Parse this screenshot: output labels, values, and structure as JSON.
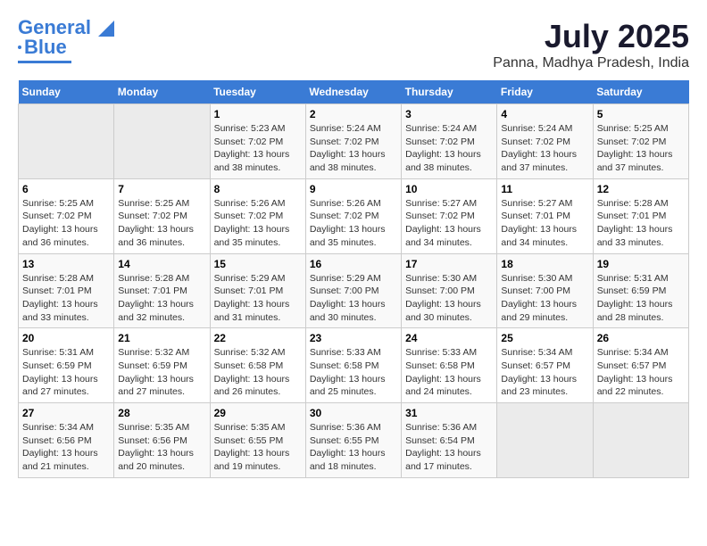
{
  "logo": {
    "text1": "General",
    "text2": "Blue"
  },
  "title": "July 2025",
  "subtitle": "Panna, Madhya Pradesh, India",
  "days_of_week": [
    "Sunday",
    "Monday",
    "Tuesday",
    "Wednesday",
    "Thursday",
    "Friday",
    "Saturday"
  ],
  "weeks": [
    [
      {
        "num": "",
        "sunrise": "",
        "sunset": "",
        "daylight": ""
      },
      {
        "num": "",
        "sunrise": "",
        "sunset": "",
        "daylight": ""
      },
      {
        "num": "1",
        "sunrise": "Sunrise: 5:23 AM",
        "sunset": "Sunset: 7:02 PM",
        "daylight": "Daylight: 13 hours and 38 minutes."
      },
      {
        "num": "2",
        "sunrise": "Sunrise: 5:24 AM",
        "sunset": "Sunset: 7:02 PM",
        "daylight": "Daylight: 13 hours and 38 minutes."
      },
      {
        "num": "3",
        "sunrise": "Sunrise: 5:24 AM",
        "sunset": "Sunset: 7:02 PM",
        "daylight": "Daylight: 13 hours and 38 minutes."
      },
      {
        "num": "4",
        "sunrise": "Sunrise: 5:24 AM",
        "sunset": "Sunset: 7:02 PM",
        "daylight": "Daylight: 13 hours and 37 minutes."
      },
      {
        "num": "5",
        "sunrise": "Sunrise: 5:25 AM",
        "sunset": "Sunset: 7:02 PM",
        "daylight": "Daylight: 13 hours and 37 minutes."
      }
    ],
    [
      {
        "num": "6",
        "sunrise": "Sunrise: 5:25 AM",
        "sunset": "Sunset: 7:02 PM",
        "daylight": "Daylight: 13 hours and 36 minutes."
      },
      {
        "num": "7",
        "sunrise": "Sunrise: 5:25 AM",
        "sunset": "Sunset: 7:02 PM",
        "daylight": "Daylight: 13 hours and 36 minutes."
      },
      {
        "num": "8",
        "sunrise": "Sunrise: 5:26 AM",
        "sunset": "Sunset: 7:02 PM",
        "daylight": "Daylight: 13 hours and 35 minutes."
      },
      {
        "num": "9",
        "sunrise": "Sunrise: 5:26 AM",
        "sunset": "Sunset: 7:02 PM",
        "daylight": "Daylight: 13 hours and 35 minutes."
      },
      {
        "num": "10",
        "sunrise": "Sunrise: 5:27 AM",
        "sunset": "Sunset: 7:02 PM",
        "daylight": "Daylight: 13 hours and 34 minutes."
      },
      {
        "num": "11",
        "sunrise": "Sunrise: 5:27 AM",
        "sunset": "Sunset: 7:01 PM",
        "daylight": "Daylight: 13 hours and 34 minutes."
      },
      {
        "num": "12",
        "sunrise": "Sunrise: 5:28 AM",
        "sunset": "Sunset: 7:01 PM",
        "daylight": "Daylight: 13 hours and 33 minutes."
      }
    ],
    [
      {
        "num": "13",
        "sunrise": "Sunrise: 5:28 AM",
        "sunset": "Sunset: 7:01 PM",
        "daylight": "Daylight: 13 hours and 33 minutes."
      },
      {
        "num": "14",
        "sunrise": "Sunrise: 5:28 AM",
        "sunset": "Sunset: 7:01 PM",
        "daylight": "Daylight: 13 hours and 32 minutes."
      },
      {
        "num": "15",
        "sunrise": "Sunrise: 5:29 AM",
        "sunset": "Sunset: 7:01 PM",
        "daylight": "Daylight: 13 hours and 31 minutes."
      },
      {
        "num": "16",
        "sunrise": "Sunrise: 5:29 AM",
        "sunset": "Sunset: 7:00 PM",
        "daylight": "Daylight: 13 hours and 30 minutes."
      },
      {
        "num": "17",
        "sunrise": "Sunrise: 5:30 AM",
        "sunset": "Sunset: 7:00 PM",
        "daylight": "Daylight: 13 hours and 30 minutes."
      },
      {
        "num": "18",
        "sunrise": "Sunrise: 5:30 AM",
        "sunset": "Sunset: 7:00 PM",
        "daylight": "Daylight: 13 hours and 29 minutes."
      },
      {
        "num": "19",
        "sunrise": "Sunrise: 5:31 AM",
        "sunset": "Sunset: 6:59 PM",
        "daylight": "Daylight: 13 hours and 28 minutes."
      }
    ],
    [
      {
        "num": "20",
        "sunrise": "Sunrise: 5:31 AM",
        "sunset": "Sunset: 6:59 PM",
        "daylight": "Daylight: 13 hours and 27 minutes."
      },
      {
        "num": "21",
        "sunrise": "Sunrise: 5:32 AM",
        "sunset": "Sunset: 6:59 PM",
        "daylight": "Daylight: 13 hours and 27 minutes."
      },
      {
        "num": "22",
        "sunrise": "Sunrise: 5:32 AM",
        "sunset": "Sunset: 6:58 PM",
        "daylight": "Daylight: 13 hours and 26 minutes."
      },
      {
        "num": "23",
        "sunrise": "Sunrise: 5:33 AM",
        "sunset": "Sunset: 6:58 PM",
        "daylight": "Daylight: 13 hours and 25 minutes."
      },
      {
        "num": "24",
        "sunrise": "Sunrise: 5:33 AM",
        "sunset": "Sunset: 6:58 PM",
        "daylight": "Daylight: 13 hours and 24 minutes."
      },
      {
        "num": "25",
        "sunrise": "Sunrise: 5:34 AM",
        "sunset": "Sunset: 6:57 PM",
        "daylight": "Daylight: 13 hours and 23 minutes."
      },
      {
        "num": "26",
        "sunrise": "Sunrise: 5:34 AM",
        "sunset": "Sunset: 6:57 PM",
        "daylight": "Daylight: 13 hours and 22 minutes."
      }
    ],
    [
      {
        "num": "27",
        "sunrise": "Sunrise: 5:34 AM",
        "sunset": "Sunset: 6:56 PM",
        "daylight": "Daylight: 13 hours and 21 minutes."
      },
      {
        "num": "28",
        "sunrise": "Sunrise: 5:35 AM",
        "sunset": "Sunset: 6:56 PM",
        "daylight": "Daylight: 13 hours and 20 minutes."
      },
      {
        "num": "29",
        "sunrise": "Sunrise: 5:35 AM",
        "sunset": "Sunset: 6:55 PM",
        "daylight": "Daylight: 13 hours and 19 minutes."
      },
      {
        "num": "30",
        "sunrise": "Sunrise: 5:36 AM",
        "sunset": "Sunset: 6:55 PM",
        "daylight": "Daylight: 13 hours and 18 minutes."
      },
      {
        "num": "31",
        "sunrise": "Sunrise: 5:36 AM",
        "sunset": "Sunset: 6:54 PM",
        "daylight": "Daylight: 13 hours and 17 minutes."
      },
      {
        "num": "",
        "sunrise": "",
        "sunset": "",
        "daylight": ""
      },
      {
        "num": "",
        "sunrise": "",
        "sunset": "",
        "daylight": ""
      }
    ]
  ]
}
